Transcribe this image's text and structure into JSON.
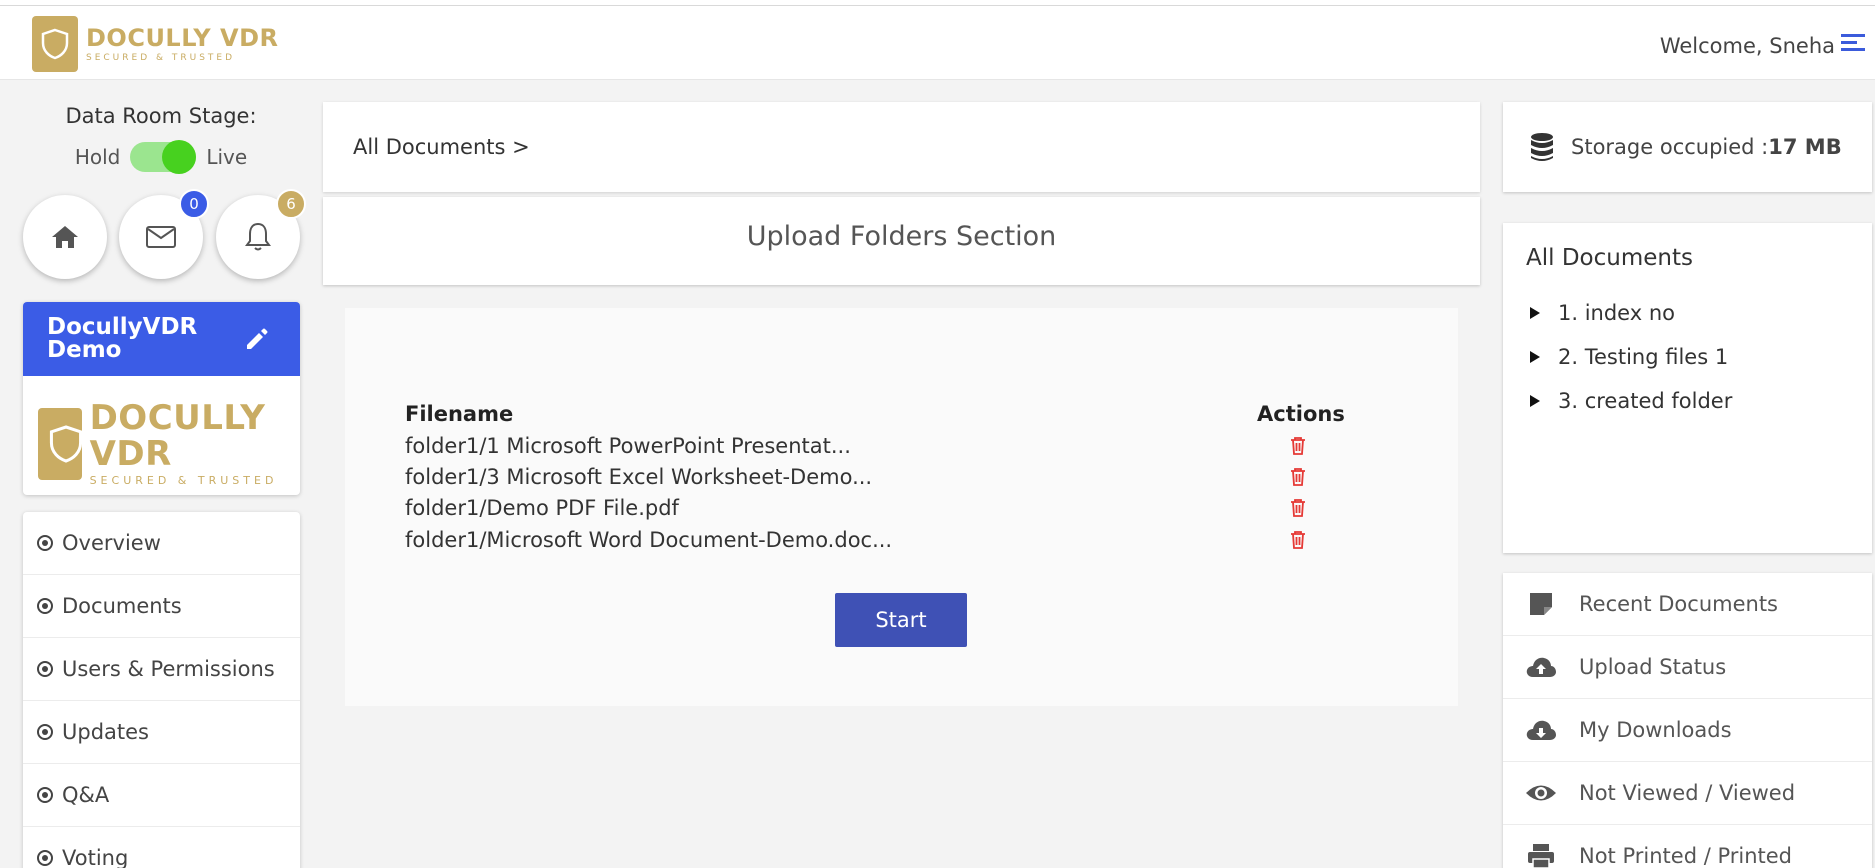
{
  "header": {
    "logo_name": "DOCULLY VDR",
    "logo_tagline": "SECURED & TRUSTED",
    "welcome": "Welcome, Sneha"
  },
  "stage": {
    "label": "Data Room Stage:",
    "off_label": "Hold",
    "on_label": "Live",
    "is_live": true
  },
  "badges": {
    "messages": "0",
    "notifications": "6",
    "messages_color": "#3b5ce6",
    "notifications_color": "#c9ac63"
  },
  "room": {
    "name": "DocullyVDR Demo",
    "header_color": "#3b5ce6"
  },
  "nav": {
    "items": [
      {
        "label": "Overview"
      },
      {
        "label": "Documents"
      },
      {
        "label": "Users & Permissions"
      },
      {
        "label": "Updates"
      },
      {
        "label": "Q&A"
      },
      {
        "label": "Voting"
      }
    ]
  },
  "breadcrumb": {
    "text": "All Documents >"
  },
  "upload": {
    "title": "Upload Folders Section",
    "col_filename": "Filename",
    "col_actions": "Actions",
    "files": [
      "folder1/1 Microsoft PowerPoint Presentat...",
      "folder1/3 Microsoft Excel Worksheet-Demo...",
      "folder1/Demo PDF File.pdf",
      "folder1/Microsoft Word Document-Demo.doc..."
    ],
    "start_label": "Start",
    "start_color": "#3f51b5",
    "delete_icon_color": "#e53935"
  },
  "storage": {
    "label": "Storage occupied :",
    "value": "17 MB"
  },
  "tree": {
    "title": "All Documents",
    "items": [
      "1. index no",
      "2. Testing files 1",
      "3. created folder"
    ]
  },
  "quick_links": {
    "items": [
      {
        "label": "Recent Documents",
        "icon": "document-icon"
      },
      {
        "label": "Upload Status",
        "icon": "cloud-upload-icon"
      },
      {
        "label": "My Downloads",
        "icon": "cloud-download-icon"
      },
      {
        "label": "Not Viewed / Viewed",
        "icon": "eye-icon"
      },
      {
        "label": "Not Printed / Printed",
        "icon": "printer-icon"
      }
    ]
  }
}
